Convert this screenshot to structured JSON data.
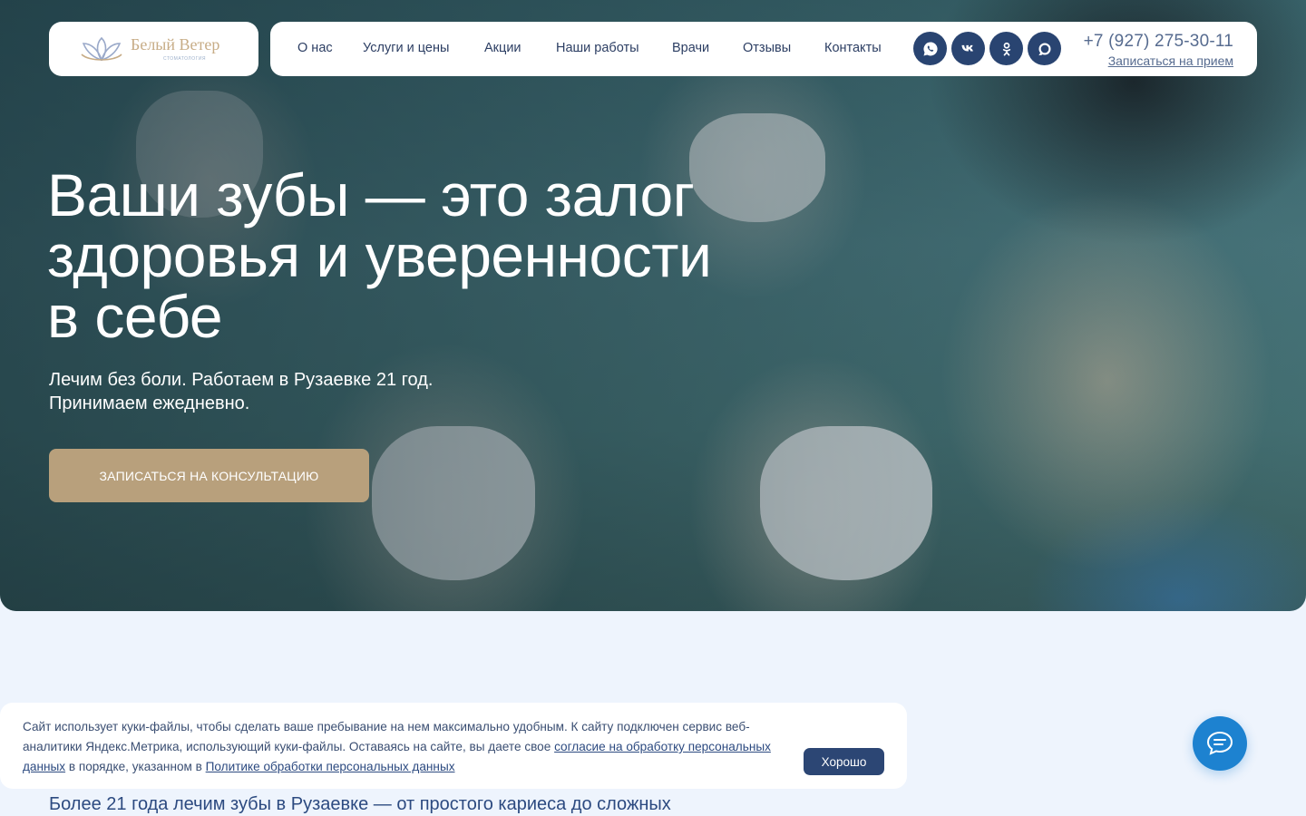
{
  "brand": {
    "name": "Белый Ветер",
    "subtitle": "СТОМАТОЛОГИЯ",
    "color": "#c7ac86"
  },
  "nav": {
    "items": [
      {
        "label": "О нас"
      },
      {
        "label": "Услуги и цены"
      },
      {
        "label": "Акции"
      },
      {
        "label": "Наши работы"
      },
      {
        "label": "Врачи"
      },
      {
        "label": "Отзывы"
      },
      {
        "label": "Контакты"
      }
    ],
    "social": [
      "whatsapp-icon",
      "vk-icon",
      "odnoklassniki-icon",
      "max-messenger-icon"
    ],
    "phone": "+7 (927) 275-30-11",
    "book_label": "Записаться на прием"
  },
  "hero": {
    "title_lines": [
      "Ваши зубы — это залог",
      "здоровья и уверенности",
      "в себе"
    ],
    "subtitle_lines": [
      "Лечим без боли. Работаем в Рузаевке 21 год.",
      "Принимаем ежедневно."
    ],
    "cta_label": "ЗАПИСАТЬСЯ НА КОНСУЛЬТАЦИЮ"
  },
  "below": {
    "text": "Более 21 года лечим зубы в Рузаевке — от простого кариеса до сложных"
  },
  "cookie": {
    "text_1": "Сайт использует куки-файлы, чтобы сделать ваше пребывание на нем максимально удобным. К сайту подключен сервис веб-аналитики Яндекс.Метрика, использующий куки-файлы. Оставаясь на сайте, вы даете свое ",
    "link_1": "согласие на обработку персональных данных",
    "text_2": " в порядке, указанном в ",
    "link_2": "Политике обработки персональных данных",
    "button_label": "Хорошо"
  },
  "colors": {
    "accent": "#294471",
    "cta": "#b8a07c",
    "chat": "#1d82d0",
    "page_bg": "#eef4fd"
  }
}
